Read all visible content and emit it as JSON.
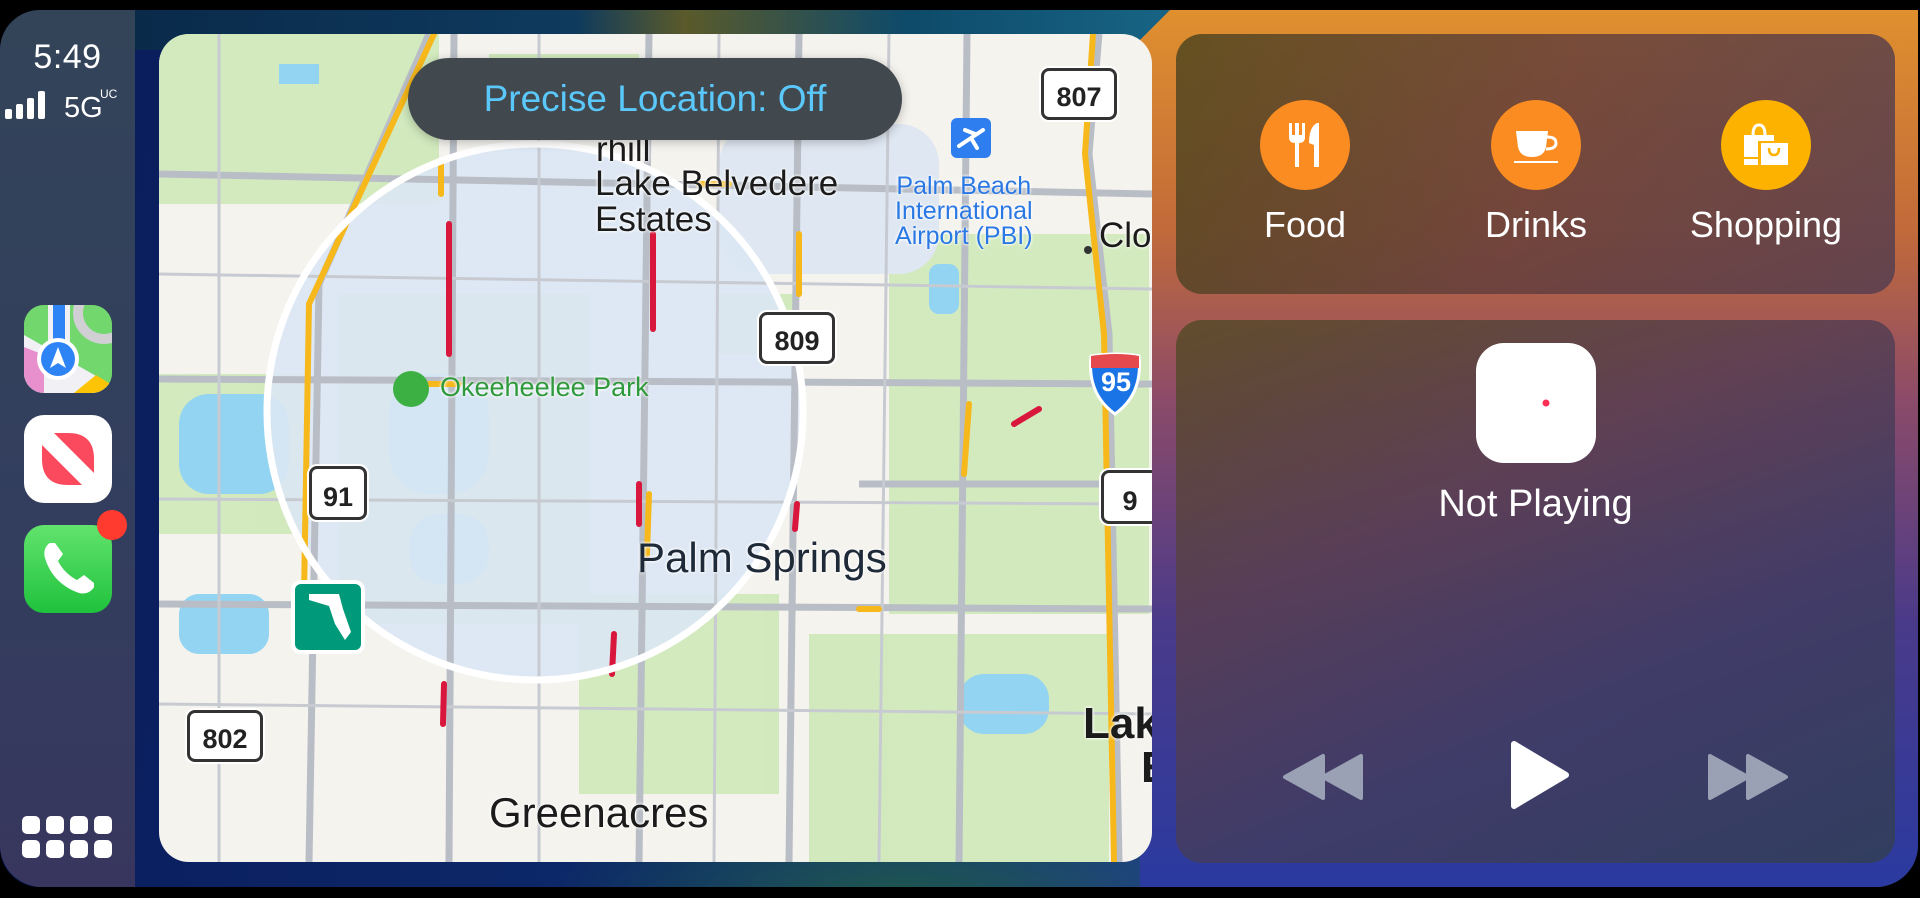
{
  "status": {
    "time": "5:49",
    "network": "5G",
    "network_suffix": "UC",
    "signal_bars": 4
  },
  "dock": {
    "apps": [
      {
        "name": "Maps"
      },
      {
        "name": "News"
      },
      {
        "name": "Phone",
        "badge": true
      }
    ],
    "app_library_icon": "grid-icon"
  },
  "map": {
    "banner": "Precise Location: Off",
    "labels": {
      "lake_belvedere_1": "Lake Belvedere",
      "lake_belvedere_2": "Estates",
      "airport_1": "Palm Beach",
      "airport_2": "International",
      "airport_3": "Airport (PBI)",
      "hill": "rhill",
      "clo": "Clo",
      "park": "Okeeheelee Park",
      "palm_springs": "Palm Springs",
      "greenacres": "Greenacres",
      "lak": "Lak",
      "lak2": "E"
    },
    "shields": {
      "s807": "807",
      "s809": "809",
      "s91": "91",
      "i95": "95",
      "s9": "9",
      "s802": "802"
    }
  },
  "categories": [
    {
      "label": "Food",
      "icon": "fork-knife-icon",
      "color": "#fb8c22"
    },
    {
      "label": "Drinks",
      "icon": "coffee-cup-icon",
      "color": "#fb8c22"
    },
    {
      "label": "Shopping",
      "icon": "shopping-bags-icon",
      "color": "#feb200"
    }
  ],
  "now_playing": {
    "status": "Not Playing"
  }
}
